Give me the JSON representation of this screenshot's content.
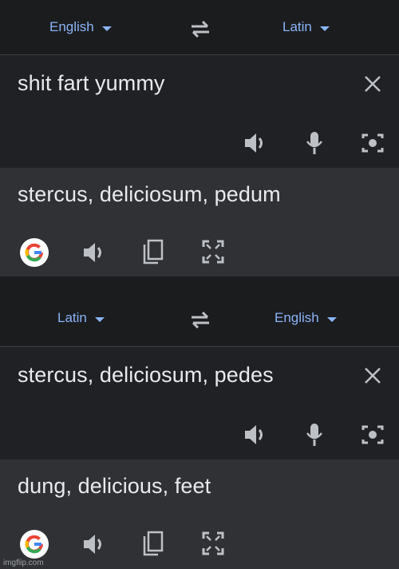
{
  "top": {
    "source_lang": "English",
    "target_lang": "Latin",
    "input_text": "shit fart yummy",
    "output_text": "stercus, deliciosum, pedum"
  },
  "bottom": {
    "source_lang": "Latin",
    "target_lang": "English",
    "input_text": "stercus, deliciosum, pedes",
    "output_text": "dung, delicious, feet"
  },
  "watermark": "imgflip.com",
  "icons": [
    "swap-icon",
    "clear-icon",
    "speaker-icon",
    "mic-icon",
    "camera-icon",
    "google-logo-icon",
    "copy-icon",
    "fullscreen-icon"
  ],
  "colors": {
    "accent": "#8ab4f8",
    "text": "#e8eaed",
    "icon": "#bdc1c6"
  }
}
